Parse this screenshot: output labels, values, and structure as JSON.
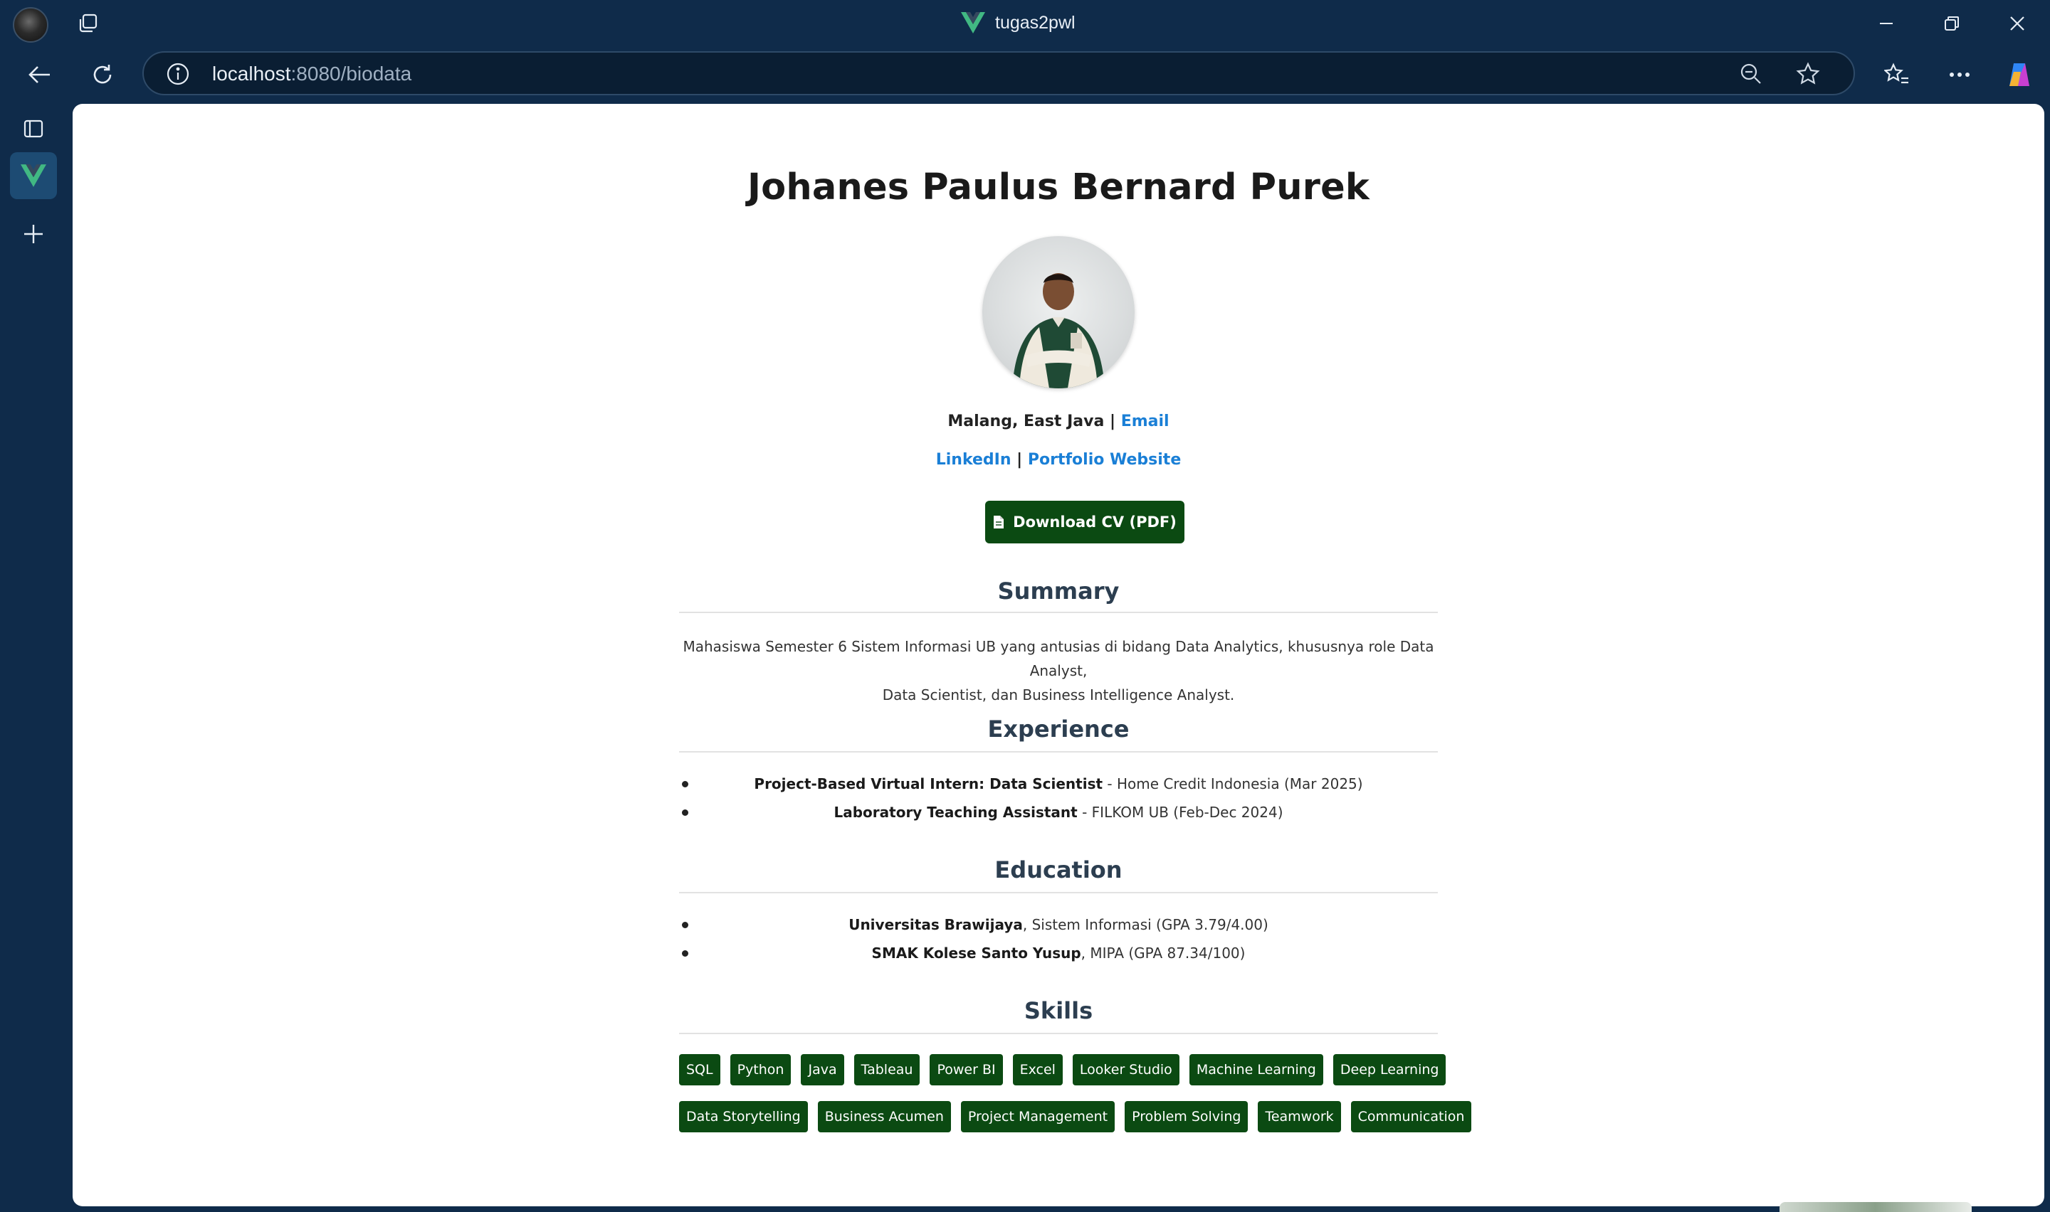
{
  "browser": {
    "tab_title": "tugas2pwl",
    "url_host": "localhost",
    "url_path": ":8080/biodata"
  },
  "profile": {
    "name": "Johanes Paulus Bernard Purek",
    "location": "Malang, East Java",
    "separator": " | ",
    "email_label": "Email",
    "linkedin_label": "LinkedIn",
    "portfolio_label": "Portfolio Website",
    "cv_button": "Download CV (PDF)"
  },
  "summary": {
    "title": "Summary",
    "line1": "Mahasiswa Semester 6 Sistem Informasi UB yang antusias di bidang Data Analytics, khususnya role Data Analyst,",
    "line2": "Data Scientist, dan Business Intelligence Analyst."
  },
  "experience": {
    "title": "Experience",
    "items": [
      {
        "role": "Project-Based Virtual Intern: Data Scientist",
        "detail": " - Home Credit Indonesia (Mar 2025)"
      },
      {
        "role": "Laboratory Teaching Assistant",
        "detail": " - FILKOM UB (Feb-Dec 2024)"
      }
    ]
  },
  "education": {
    "title": "Education",
    "items": [
      {
        "school": "Universitas Brawijaya",
        "detail": ", Sistem Informasi (GPA 3.79/4.00)"
      },
      {
        "school": "SMAK Kolese Santo Yusup",
        "detail": ", MIPA (GPA 87.34/100)"
      }
    ]
  },
  "skills": {
    "title": "Skills",
    "row1": [
      "SQL",
      "Python",
      "Java",
      "Tableau",
      "Power BI",
      "Excel",
      "Looker Studio",
      "Machine Learning",
      "Deep Learning"
    ],
    "row2": [
      "Data Storytelling",
      "Business Acumen",
      "Project Management",
      "Problem Solving",
      "Teamwork",
      "Communication"
    ]
  },
  "colors": {
    "chrome": "#0f2b4a",
    "accent_green": "#0b4a12",
    "link_blue": "#1a7fd6"
  }
}
